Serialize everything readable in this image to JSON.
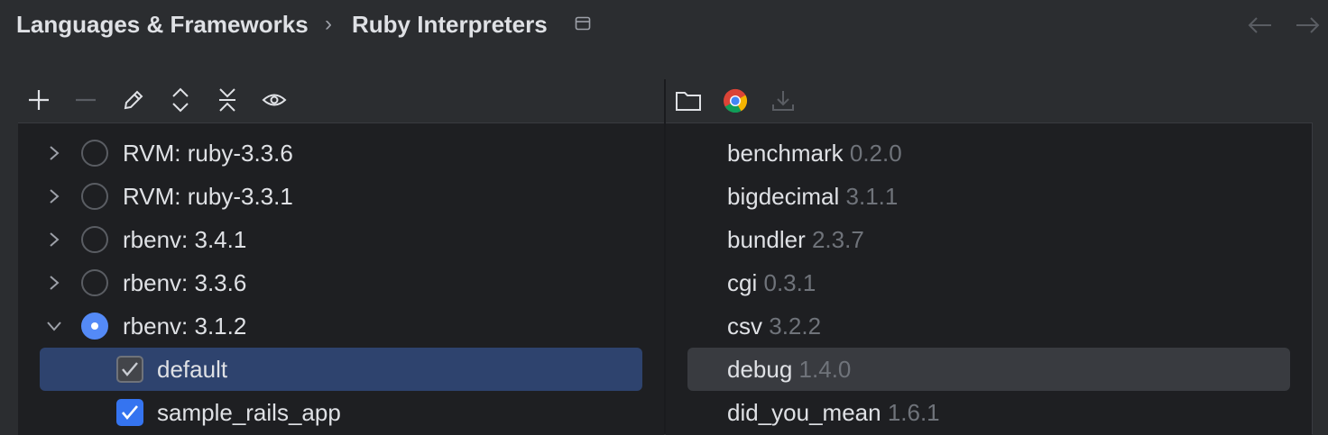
{
  "header": {
    "crumb_parent": "Languages & Frameworks",
    "separator": "›",
    "crumb_current": "Ruby Interpreters",
    "layout_icon": "window-icon",
    "back_icon": "arrow-left-icon",
    "forward_icon": "arrow-right-icon"
  },
  "left_toolbar": {
    "icons": [
      "add-icon",
      "remove-icon",
      "edit-icon",
      "expand-all-icon",
      "collapse-all-icon",
      "eye-icon"
    ]
  },
  "right_toolbar": {
    "icons": [
      "folder-icon",
      "chrome-icon",
      "download-icon"
    ]
  },
  "interpreters": [
    {
      "label": "RVM: ruby-3.3.6",
      "expanded": false,
      "selected": false
    },
    {
      "label": "RVM: ruby-3.3.1",
      "expanded": false,
      "selected": false
    },
    {
      "label": "rbenv: 3.4.1",
      "expanded": false,
      "selected": false
    },
    {
      "label": "rbenv: 3.3.6",
      "expanded": false,
      "selected": false
    },
    {
      "label": "rbenv: 3.1.2",
      "expanded": true,
      "selected": true
    }
  ],
  "gemsets": [
    {
      "label": "default",
      "checked": true,
      "highlighted": true
    },
    {
      "label": "sample_rails_app",
      "checked": true,
      "highlighted": false
    }
  ],
  "gems": [
    {
      "name": "benchmark",
      "version": "0.2.0"
    },
    {
      "name": "bigdecimal",
      "version": "3.1.1"
    },
    {
      "name": "bundler",
      "version": "2.3.7"
    },
    {
      "name": "cgi",
      "version": "0.3.1"
    },
    {
      "name": "csv",
      "version": "3.2.2"
    },
    {
      "name": "debug",
      "version": "1.4.0"
    },
    {
      "name": "did_you_mean",
      "version": "1.6.1"
    }
  ],
  "colors": {
    "background": "#2b2d30",
    "panel": "#1e1f22",
    "selection": "#2e436e",
    "accent": "#548af7",
    "checkbox_blue": "#3574f0",
    "muted_text": "#6f737a"
  }
}
